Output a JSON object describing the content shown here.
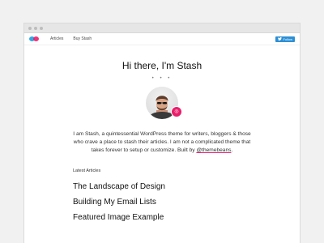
{
  "nav": {
    "items": [
      "Articles",
      "Buy Stash"
    ],
    "follow_label": "Follow"
  },
  "hero": {
    "greeting": "Hi there, I'm Stash",
    "separator": "• • •",
    "bio": "I am Stash, a quintessential WordPress theme for writers, bloggers & those who crave a place to stash their articles. I am not a complicated theme that takes forever to setup or customize. Built by ",
    "bio_link": "@themebeans",
    "bio_end": "."
  },
  "latest": {
    "heading": "Latest Articles",
    "articles": [
      "The Landscape of Design",
      "Building My Email Lists",
      "Featured Image Example"
    ]
  },
  "colors": {
    "accent": "#e91e6b",
    "twitter": "#2c8fd6",
    "logo_blue": "#2ea9e6"
  },
  "icons": {
    "logo": "stash-logo-icon",
    "twitter": "twitter-bird-icon",
    "badge": "dribbble-icon"
  }
}
